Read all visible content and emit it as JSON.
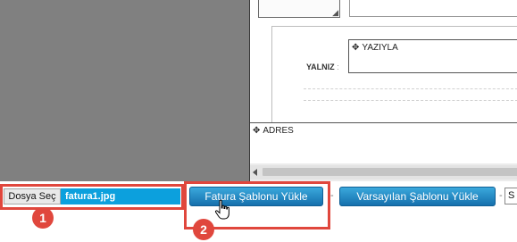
{
  "document": {
    "yaziyla_label": "YAZIYLA",
    "yalniz_label": "YALNIZ",
    "yalniz_colon": ":",
    "adres_label": "ADRES"
  },
  "toolbar": {
    "file_button_label": "Dosya Seç",
    "file_name": "fatura1.jpg",
    "load_template_label": "Fatura Şablonu Yükle",
    "default_template_label": "Varsayılan Şablonu Yükle",
    "separator": "-",
    "clipped_input_value": "S"
  },
  "annotations": {
    "step1": "1",
    "step2": "2"
  },
  "colors": {
    "highlight": "#e0473d",
    "button_blue": "#1a86c6",
    "file_name_bg": "#0ca0dd"
  },
  "icons": [
    "move-icon",
    "resize-grip-icon",
    "hand-cursor-icon",
    "scroll-left-arrow-icon"
  ]
}
